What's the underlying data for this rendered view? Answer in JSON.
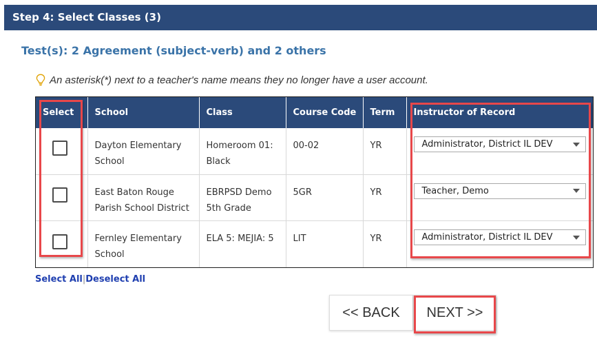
{
  "header": {
    "title": "Step 4: Select Classes (3)"
  },
  "tests_line": "Test(s): 2 Agreement (subject-verb) and 2 others",
  "note": {
    "icon": "lightbulb-icon",
    "text": "An asterisk(*) next to a teacher's name means they no longer have a user account."
  },
  "table": {
    "columns": [
      "Select",
      "School",
      "Class",
      "Course Code",
      "Term",
      "Instructor of Record"
    ],
    "rows": [
      {
        "school": "Dayton Elementary School",
        "class": "Homeroom 01: Black",
        "course_code": "00-02",
        "term": "YR",
        "instructor": "Administrator, District IL DEV"
      },
      {
        "school": "East Baton Rouge Parish School District",
        "class": "EBRPSD Demo 5th Grade",
        "course_code": "5GR",
        "term": "YR",
        "instructor": "Teacher, Demo"
      },
      {
        "school": "Fernley Elementary School",
        "class": "ELA 5: MEJIA: 5",
        "course_code": "LIT",
        "term": "YR",
        "instructor": "Administrator, District IL DEV"
      }
    ]
  },
  "links": {
    "select_all": "Select All",
    "separator": "|",
    "deselect_all": "Deselect All"
  },
  "buttons": {
    "back": "<< BACK",
    "next": "NEXT >>"
  },
  "colors": {
    "header_bg": "#2b4a7a",
    "accent_text": "#3a73a8",
    "highlight": "#e8474a",
    "link": "#1f3fb0"
  }
}
